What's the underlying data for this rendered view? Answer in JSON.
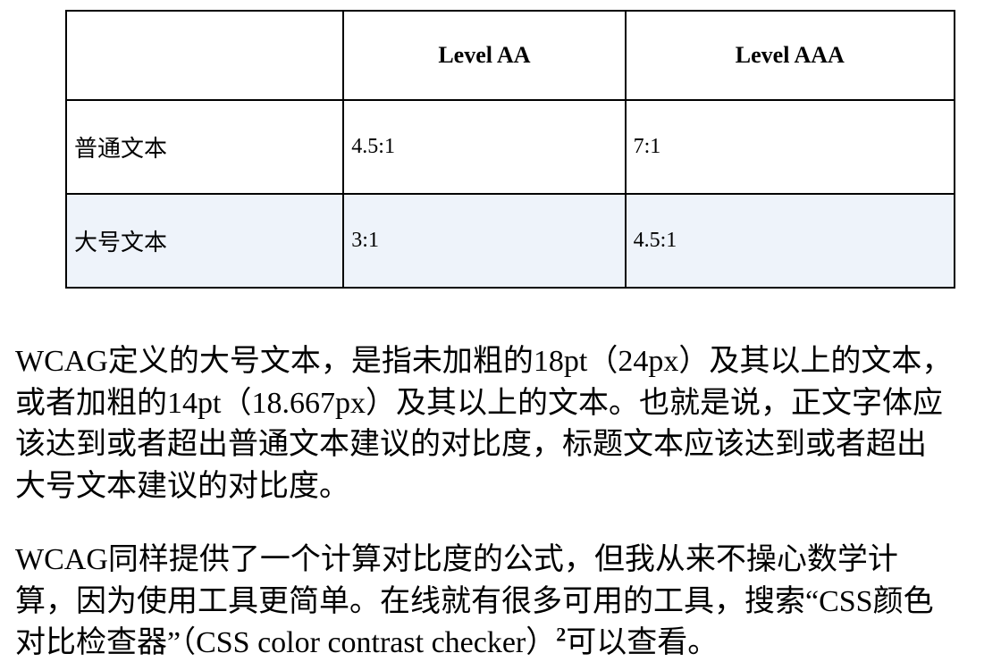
{
  "table": {
    "headers": [
      "",
      "Level AA",
      "Level AAA"
    ],
    "rows": [
      {
        "label": "普通文本",
        "aa": "4.5:1",
        "aaa": "7:1"
      },
      {
        "label": "大号文本",
        "aa": "3:1",
        "aaa": "4.5:1"
      }
    ],
    "shaded_row_color": "#eef3fa"
  },
  "paragraph1": {
    "lines": [
      "WCAG定义的大号文本，是指未加粗的18pt（24px）及其以上的文本，",
      "或者加粗的14pt（18.667px）及其以上的文本。也就是说，正文字体应",
      "该达到或者超出普通文本建议的对比度，标题文本应该达到或者超出",
      "大号文本建议的对比度。"
    ]
  },
  "paragraph2": {
    "lines": [
      "WCAG同样提供了一个计算对比度的公式，但我从来不操心数学计",
      "算，因为使用工具更简单。在线就有很多可用的工具，搜索“CSS颜色",
      "对比检查器”（CSS color contrast checker）",
      "可以查看。"
    ],
    "footnote_marker": "2"
  }
}
